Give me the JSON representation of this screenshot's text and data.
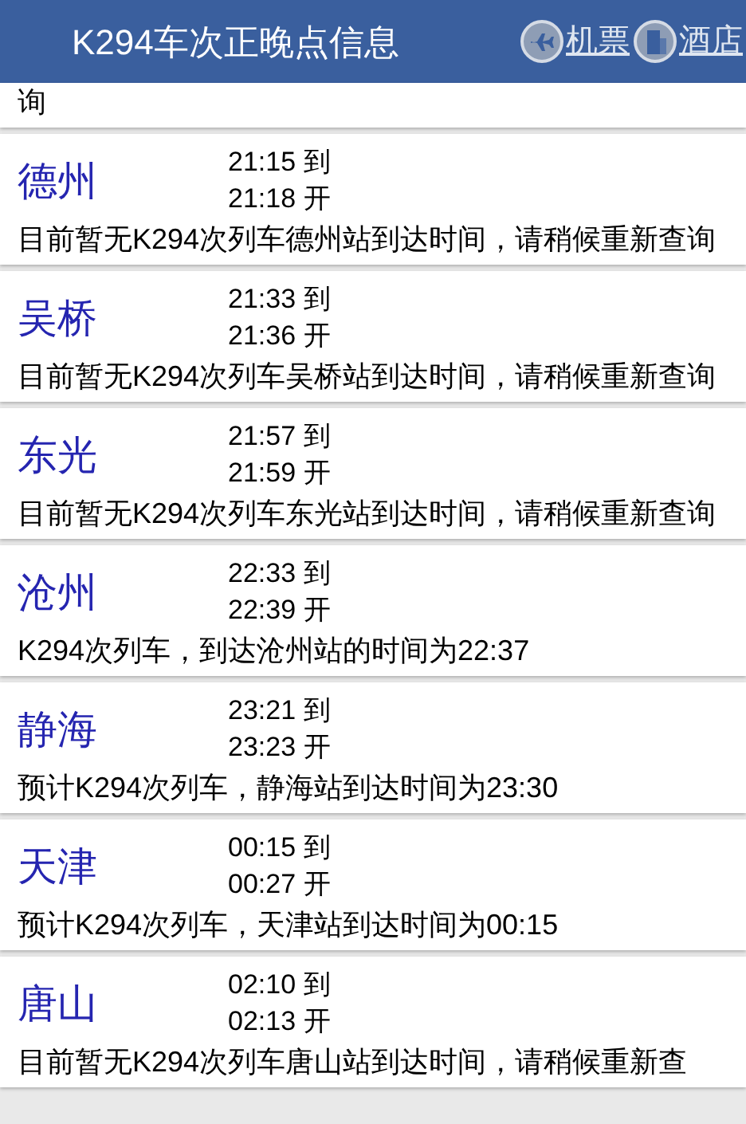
{
  "header": {
    "title": "K294车次正晚点信息",
    "links": [
      {
        "kind": "plane",
        "label": "机票"
      },
      {
        "kind": "hotel",
        "label": "酒店"
      }
    ]
  },
  "stops": [
    {
      "status": "询"
    },
    {
      "name": "德州",
      "arrive": "21:15 到",
      "depart": "21:18 开",
      "status": "目前暂无K294次列车德州站到达时间，请稍候重新查询"
    },
    {
      "name": "吴桥",
      "arrive": "21:33 到",
      "depart": "21:36 开",
      "status": "目前暂无K294次列车吴桥站到达时间，请稍候重新查询"
    },
    {
      "name": "东光",
      "arrive": "21:57 到",
      "depart": "21:59 开",
      "status": "目前暂无K294次列车东光站到达时间，请稍候重新查询"
    },
    {
      "name": "沧州",
      "arrive": "22:33 到",
      "depart": "22:39 开",
      "status": "K294次列车，到达沧州站的时间为22:37"
    },
    {
      "name": "静海",
      "arrive": "23:21 到",
      "depart": "23:23 开",
      "status": "预计K294次列车，静海站到达时间为23:30"
    },
    {
      "name": "天津",
      "arrive": "00:15 到",
      "depart": "00:27 开",
      "status": "预计K294次列车，天津站到达时间为00:15"
    },
    {
      "name": "唐山",
      "arrive": "02:10 到",
      "depart": "02:13 开",
      "status": "目前暂无K294次列车唐山站到达时间，请稍候重新查"
    }
  ]
}
